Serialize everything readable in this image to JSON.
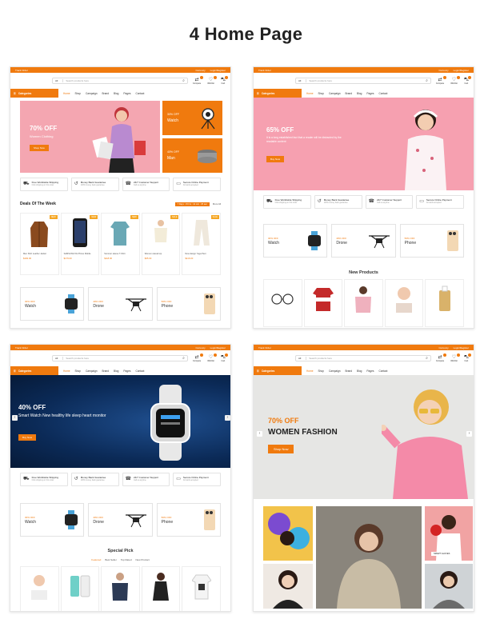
{
  "page": {
    "title": "4 Home Page"
  },
  "shared": {
    "announce_left": "Track Order",
    "announce_currency": "Currency",
    "announce_login": "Login/Register",
    "search_category": "All",
    "search_placeholder": "Search products here",
    "compare": "Compare",
    "wishlist": "Wishlist",
    "cart": "Cart",
    "categories": "Categories",
    "nav": [
      "Home",
      "Shop",
      "Campaign",
      "Brand",
      "Blog",
      "Pages",
      "Contact"
    ],
    "features": [
      {
        "title": "Free Worldwide Shipping",
        "sub": "Click shipping on first order"
      },
      {
        "title": "Money Back Guarantee",
        "sub": "100% money back guarantee"
      },
      {
        "title": "24/7 Customer Support",
        "sub": "Call us anytime"
      },
      {
        "title": "Secure Online Payment",
        "sub": "All cards accepted"
      }
    ],
    "promo": [
      {
        "off": "30% OFF",
        "name": "Watch"
      },
      {
        "off": "40% OFF",
        "name": "Drone"
      },
      {
        "off": "50% OFF",
        "name": "Phone"
      }
    ]
  },
  "home1": {
    "hero_off": "70% OFF",
    "hero_sub": "Women Clothing",
    "hero_btn": "Shop Now",
    "side1_off": "30% OFF",
    "side1_name": "Watch",
    "side2_off": "40% OFF",
    "side2_name": "Man",
    "deals_title": "Deals Of The Week",
    "deals_timer": "7 Days : 15 hrs : 41 min : 25 sec",
    "deals_more": "More All",
    "deals": [
      {
        "name": "Men Shirt Leather Jacket",
        "price": "$182.00",
        "tag": "NEW"
      },
      {
        "name": "SAMSUNG 5G Phone Mobile",
        "price": "$179.00",
        "tag": "NEW"
      },
      {
        "name": "Summer sleeve T-Shirt",
        "price": "$118.00",
        "tag": "NEW"
      },
      {
        "name": "Women casual top",
        "price": "$65.00",
        "tag": "SALE"
      },
      {
        "name": "New design Yoga Pant",
        "price": "$116.00",
        "tag": "SALE"
      }
    ]
  },
  "home2": {
    "hero_off": "65% OFF",
    "hero_sub": "It is a long established fact that a reader will be distracted by the readable content",
    "hero_btn": "Buy Now",
    "new_title": "New Products"
  },
  "home3": {
    "hero_off": "40% OFF",
    "hero_line": "Smart Watch New healthy life sleep heart monitor",
    "hero_btn": "Buy Now",
    "pick_title": "Special Pick",
    "pick_tabs": [
      "Featured",
      "Best Seller",
      "Top Rated",
      "New Product"
    ]
  },
  "home4": {
    "hero_off": "70% OFF",
    "hero_title": "WOMEN FASHION",
    "hero_btn": "Shop Now",
    "gallery_label": "SMART GLOVES"
  },
  "colors": {
    "accent": "#f07a0e",
    "pink": "#f6a7b5",
    "navy": "#0b2a57"
  }
}
